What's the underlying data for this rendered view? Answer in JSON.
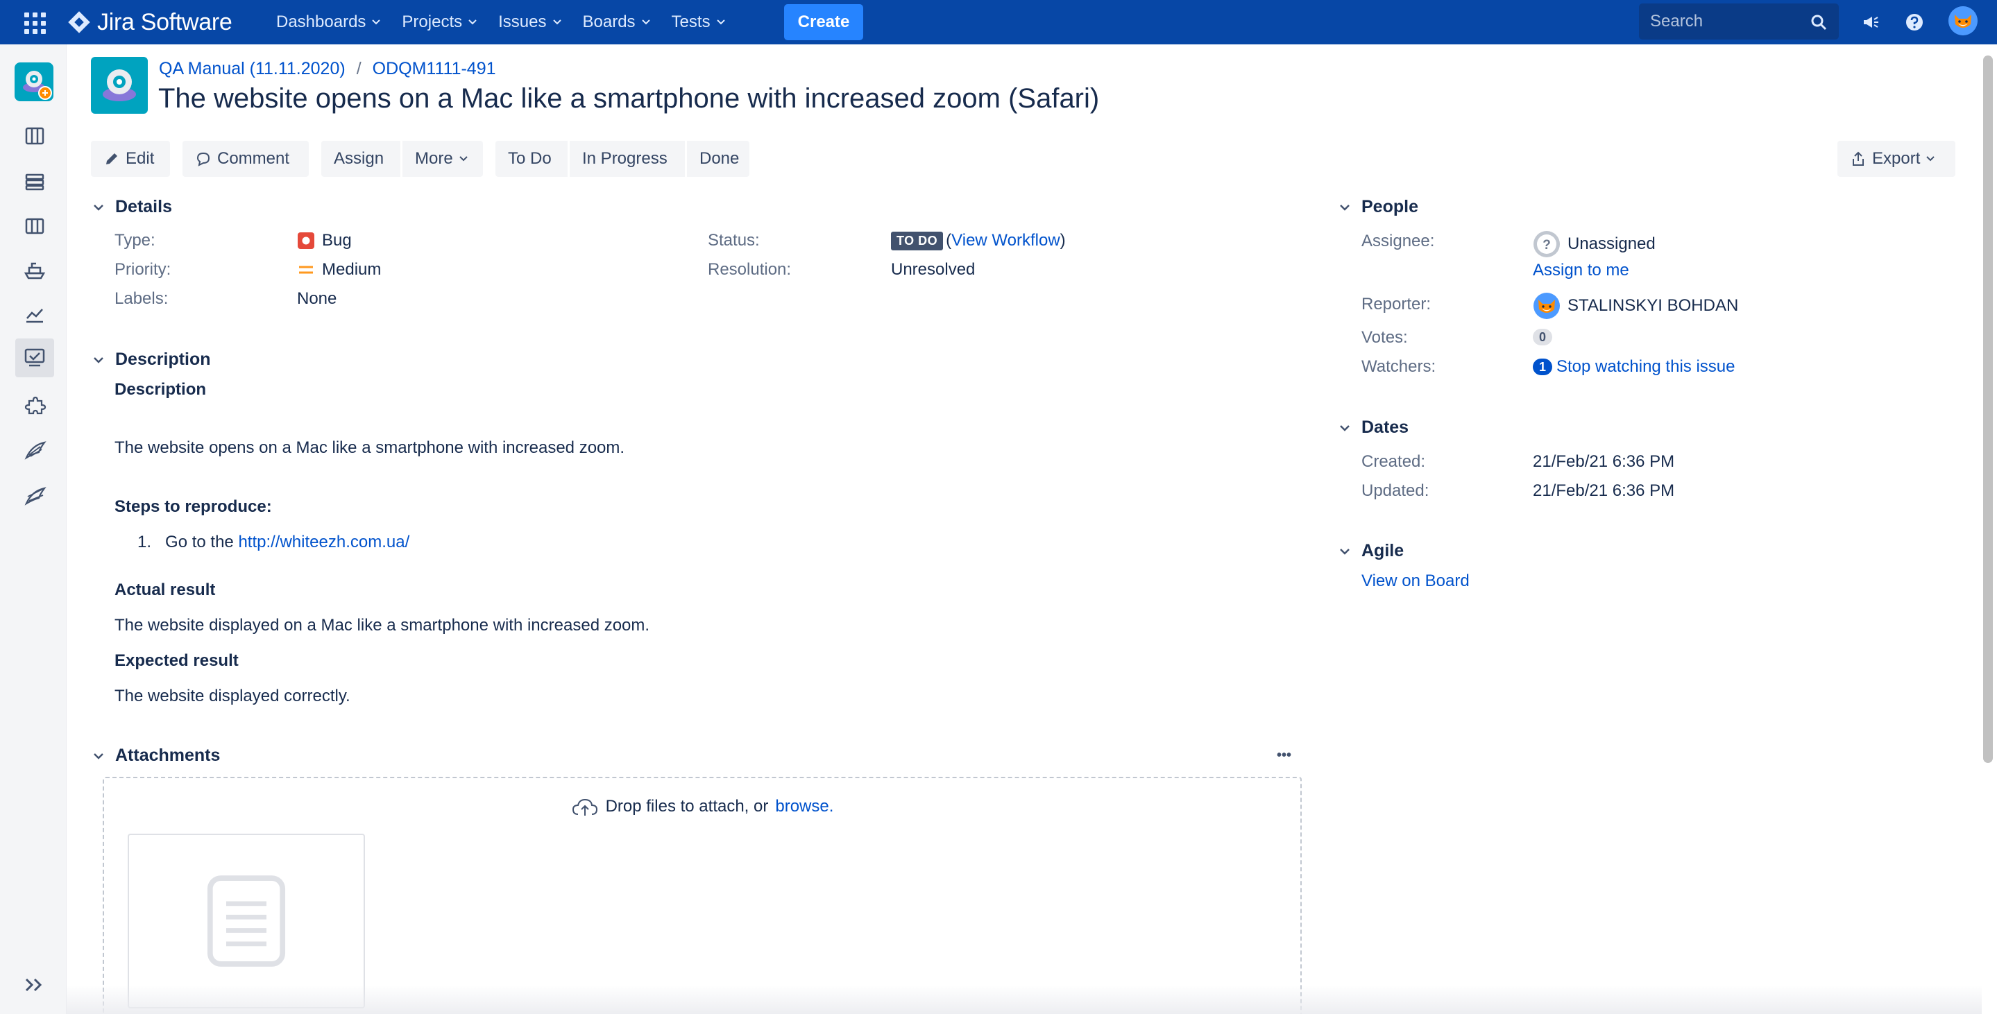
{
  "topbar": {
    "app_name": "Jira Software",
    "nav": [
      "Dashboards",
      "Projects",
      "Issues",
      "Boards",
      "Tests"
    ],
    "create_label": "Create",
    "search_placeholder": "Search"
  },
  "issue": {
    "project_link": "QA Manual (11.11.2020)",
    "breadcrumb_sep": "/",
    "key": "ODQM1111-491",
    "title": "The website opens on a Mac like a smartphone with increased zoom (Safari)"
  },
  "toolbar": {
    "edit": "Edit",
    "comment": "Comment",
    "assign": "Assign",
    "more": "More",
    "to_do": "To Do",
    "in_progress": "In Progress",
    "done": "Done",
    "export": "Export"
  },
  "details": {
    "heading": "Details",
    "type_label": "Type:",
    "type_value": "Bug",
    "priority_label": "Priority:",
    "priority_value": "Medium",
    "labels_label": "Labels:",
    "labels_value": "None",
    "status_label": "Status:",
    "status_badge": "TO DO",
    "status_open_paren": "(",
    "status_link": "View Workflow",
    "status_close_paren": ")",
    "resolution_label": "Resolution:",
    "resolution_value": "Unresolved"
  },
  "description": {
    "heading": "Description",
    "subheading": "Description",
    "summary": "The website opens on a Mac like a smartphone with increased zoom.",
    "steps_heading": "Steps to reproduce:",
    "step_number": "1.",
    "step_text": "Go to the",
    "step_link": "http://whiteezh.com.ua/",
    "actual_heading": "Actual result",
    "actual_text": "The website displayed on a Mac like a smartphone with increased zoom.",
    "expected_heading": "Expected result",
    "expected_text": "The website displayed correctly."
  },
  "attachments": {
    "heading": "Attachments",
    "more_label": "•••",
    "drop_text": "Drop files to attach, or",
    "browse_link": "browse."
  },
  "people": {
    "heading": "People",
    "assignee_label": "Assignee:",
    "assignee_value": "Unassigned",
    "assign_to_me": "Assign to me",
    "reporter_label": "Reporter:",
    "reporter_value": "STALINSKYI BOHDAN",
    "votes_label": "Votes:",
    "votes_value": "0",
    "watchers_label": "Watchers:",
    "watchers_value": "1",
    "watch_link": "Stop watching this issue"
  },
  "dates": {
    "heading": "Dates",
    "created_label": "Created:",
    "created_value": "21/Feb/21 6:36 PM",
    "updated_label": "Updated:",
    "updated_value": "21/Feb/21 6:36 PM"
  },
  "agile": {
    "heading": "Agile",
    "board_link": "View on Board"
  },
  "colors": {
    "nav_bg": "#0747a6",
    "create_bg": "#2684ff",
    "link": "#0052cc",
    "bug": "#e5493a",
    "medium_priority": "#ff991f"
  }
}
